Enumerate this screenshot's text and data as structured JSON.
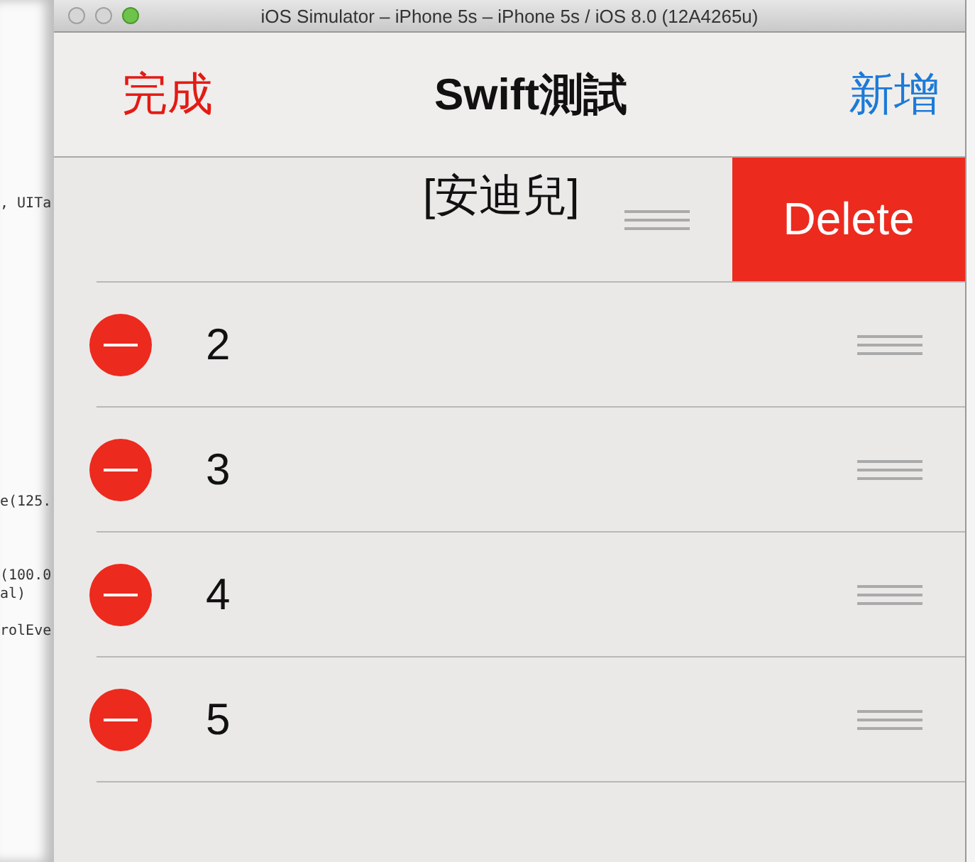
{
  "background_code": [
    ", UITa",
    "e(125.",
    "(100.0",
    "al)",
    "rolEve"
  ],
  "window": {
    "title": "iOS Simulator – iPhone 5s – iPhone 5s / iOS 8.0 (12A4265u)"
  },
  "nav_bar": {
    "left_button": "完成",
    "title": "Swift測試",
    "right_button": "新增"
  },
  "rows": [
    {
      "label": "[安迪兒]",
      "swiped": true,
      "delete_label": "Delete"
    },
    {
      "label": "2",
      "swiped": false
    },
    {
      "label": "3",
      "swiped": false
    },
    {
      "label": "4",
      "swiped": false
    },
    {
      "label": "5",
      "swiped": false
    }
  ]
}
